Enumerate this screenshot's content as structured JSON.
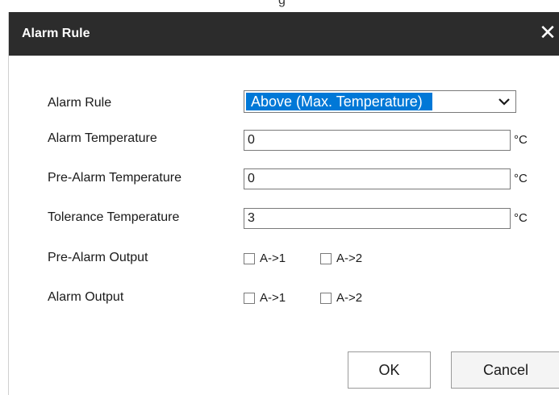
{
  "background_text": "g",
  "dialog": {
    "title": "Alarm Rule",
    "close_icon": "close-icon"
  },
  "form": {
    "alarm_rule": {
      "label": "Alarm Rule",
      "selected": "Above (Max. Temperature)"
    },
    "alarm_temperature": {
      "label": "Alarm Temperature",
      "value": "0",
      "unit": "°C"
    },
    "pre_alarm_temperature": {
      "label": "Pre-Alarm Temperature",
      "value": "0",
      "unit": "°C"
    },
    "tolerance_temperature": {
      "label": "Tolerance Temperature",
      "value": "3",
      "unit": "°C"
    },
    "pre_alarm_output": {
      "label": "Pre-Alarm Output",
      "options": [
        {
          "label": "A->1",
          "checked": false
        },
        {
          "label": "A->2",
          "checked": false
        }
      ]
    },
    "alarm_output": {
      "label": "Alarm Output",
      "options": [
        {
          "label": "A->1",
          "checked": false
        },
        {
          "label": "A->2",
          "checked": false
        }
      ]
    }
  },
  "buttons": {
    "ok": "OK",
    "cancel": "Cancel"
  },
  "colors": {
    "titlebar": "#2c2c2c",
    "selection": "#0078d7"
  }
}
